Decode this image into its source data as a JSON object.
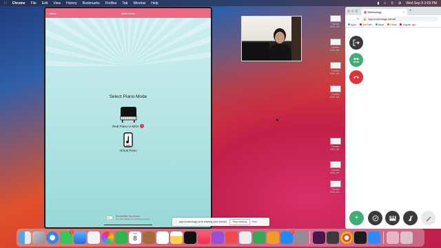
{
  "menubar": {
    "app": "Chrome",
    "items": [
      "File",
      "Edit",
      "View",
      "History",
      "Bookmarks",
      "Profiles",
      "Tab",
      "Window",
      "Help"
    ],
    "clock": "Wed Sep 8 2:09 PM"
  },
  "ipad": {
    "nav_title": "Note Class",
    "back_label": "‹ Back",
    "heading": "Select Piano Mode",
    "option_real": "Real Piano or MIDI",
    "option_real_badge": "!",
    "option_virtual": "Virtual Piano",
    "remember_title": "Remember my choice",
    "remember_sub": "You can change it in settings anytime."
  },
  "desktop_icons": [
    {
      "line1": "Screen",
      "line2": "2021-09..."
    },
    {
      "line1": "Screen",
      "line2": "2021-09..."
    },
    {
      "line1": "Screen",
      "line2": "2021-09..."
    },
    {
      "line1": "Screen",
      "line2": "2021-09..."
    },
    {
      "line1": "Screen",
      "line2": "2021-09..."
    },
    {
      "line1": "Screen",
      "line2": "2021-09..."
    },
    {
      "line1": "Screen",
      "line2": "2021-09..."
    }
  ],
  "chrome": {
    "tab_title": "Musicology",
    "url": "app.musicology.ca/call",
    "bookmarks": [
      "Apps",
      "YouTube",
      "Maps",
      "Gmail",
      "Angular ngo"
    ],
    "colors": {
      "green": "#3fae74",
      "red": "#e5303a",
      "dark": "#3a3a3a"
    }
  },
  "sharebar": {
    "message": "app.musicology.ca is sharing your screen.",
    "stop": "Stop sharing",
    "hide": "Hide"
  },
  "dock": {
    "calendar_month": "SEP",
    "calendar_day": "8",
    "badges": {
      "messages": "3",
      "mail": "",
      "appstore": "1"
    }
  }
}
